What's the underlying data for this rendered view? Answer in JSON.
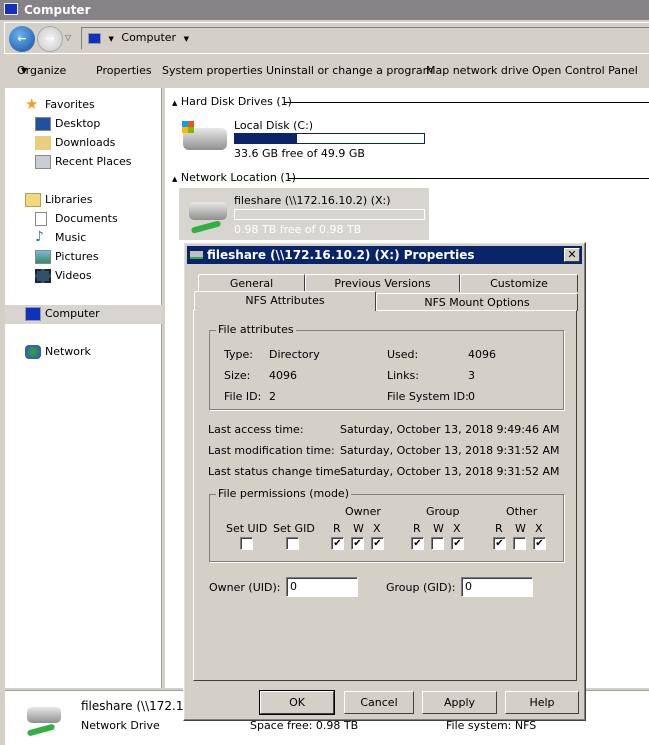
{
  "window": {
    "title": "Computer"
  },
  "address": {
    "path": "Computer"
  },
  "toolbar": {
    "items": [
      "Organize",
      "Properties",
      "System properties",
      "Uninstall or change a program",
      "Map network drive",
      "Open Control Panel"
    ]
  },
  "sidebar": {
    "favorites": "Favorites",
    "favorites_items": [
      "Desktop",
      "Downloads",
      "Recent Places"
    ],
    "libraries": "Libraries",
    "libraries_items": [
      "Documents",
      "Music",
      "Pictures",
      "Videos"
    ],
    "computer": "Computer",
    "network": "Network"
  },
  "content": {
    "hdd_group": "Hard Disk Drives (1)",
    "local_disk": {
      "name": "Local Disk (C:)",
      "free": "33.6 GB free of 49.9 GB",
      "used_fraction": 0.33
    },
    "net_group": "Network Location (1)",
    "net_drive": {
      "name": "fileshare (\\\\172.16.10.2) (X:)",
      "free": "0.98 TB free of 0.98 TB",
      "used_fraction": 0.0
    }
  },
  "details": {
    "name": "fileshare (\\\\172.16.10.2) (X:)",
    "type": "Network Drive",
    "space_free": "Space free: 0.98 TB",
    "file_system": "File system: NFS"
  },
  "dialog": {
    "title": "fileshare (\\\\172.16.10.2) (X:) Properties",
    "tabs_back": [
      "General",
      "Previous Versions",
      "Customize"
    ],
    "tabs_front": [
      "NFS Attributes",
      "NFS Mount Options"
    ],
    "active_tab": "NFS Attributes",
    "attributes": {
      "legend": "File attributes",
      "type_label": "Type:",
      "type": "Directory",
      "size_label": "Size:",
      "size": "4096",
      "fileid_label": "File ID:",
      "fileid": "2",
      "used_label": "Used:",
      "used": "4096",
      "links_label": "Links:",
      "links": "3",
      "fsid_label": "File System ID:",
      "fsid": "0"
    },
    "times": {
      "access_label": "Last access time:",
      "access": "Saturday, October 13, 2018 9:49:46 AM",
      "mod_label": "Last modification time:",
      "mod": "Saturday, October 13, 2018 9:31:52 AM",
      "status_label": "Last status change time:",
      "status": "Saturday, October 13, 2018 9:31:52 AM"
    },
    "perms": {
      "legend": "File permissions (mode)",
      "setuid": "Set UID",
      "setgid": "Set GID",
      "owner": "Owner",
      "group": "Group",
      "other": "Other",
      "r": "R",
      "w": "W",
      "x": "X",
      "setuid_checked": false,
      "setgid_checked": false,
      "owner_rwx": [
        true,
        true,
        true
      ],
      "group_rwx": [
        true,
        false,
        true
      ],
      "other_rwx": [
        true,
        false,
        true
      ]
    },
    "owner_uid_label": "Owner (UID):",
    "owner_uid": "0",
    "group_gid_label": "Group (GID):",
    "group_gid": "0",
    "buttons": {
      "ok": "OK",
      "cancel": "Cancel",
      "apply": "Apply",
      "help": "Help"
    }
  }
}
